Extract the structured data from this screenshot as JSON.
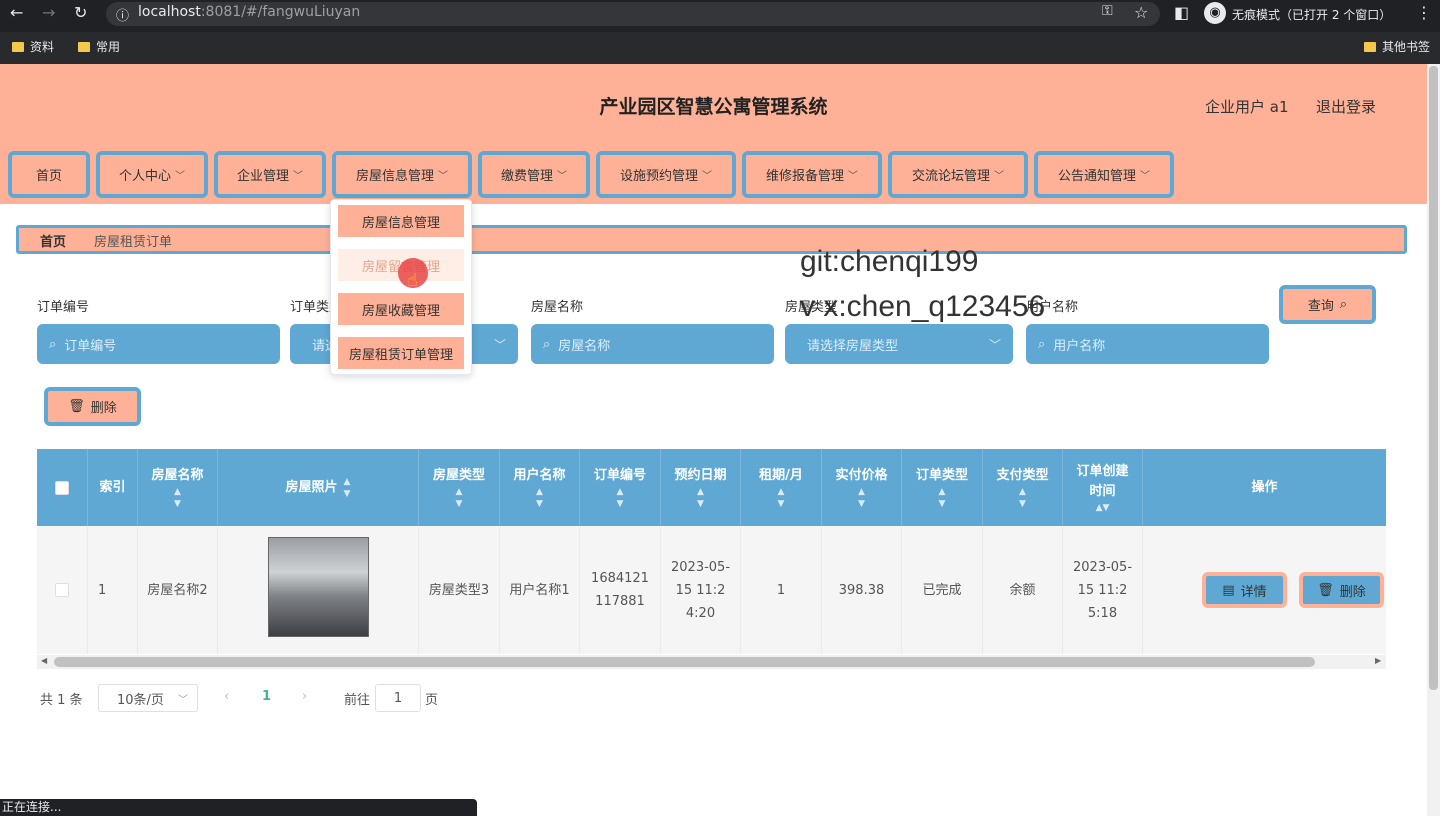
{
  "browser": {
    "url_host": "localhost",
    "url_rest": ":8081/#/fangwuLiuyan",
    "incognito": "无痕模式（已打开 2 个窗口）",
    "bookmarks": [
      "资料",
      "常用"
    ],
    "other_bookmarks": "其他书签",
    "status": "正在连接..."
  },
  "header": {
    "title": "产业园区智慧公寓管理系统",
    "user": "企业用户 a1",
    "logout": "退出登录"
  },
  "nav": {
    "items": [
      "首页",
      "个人中心",
      "企业管理",
      "房屋信息管理",
      "缴费管理",
      "设施预约管理",
      "维修报备管理",
      "交流论坛管理",
      "公告通知管理"
    ]
  },
  "dropdown": {
    "items": [
      "房屋信息管理",
      "房屋留言管理",
      "房屋收藏管理",
      "房屋租赁订单管理"
    ]
  },
  "breadcrumb": {
    "home": "首页",
    "current": "房屋租赁订单"
  },
  "watermark": {
    "line1": "git:chenqi199",
    "line2": "v x:chen_q123456"
  },
  "filters": {
    "order_no_label": "订单编号",
    "order_no_placeholder": "订单编号",
    "order_type_label": "订单类型",
    "order_type_placeholder": "请选择订单类型",
    "house_name_label": "房屋名称",
    "house_name_placeholder": "房屋名称",
    "house_type_label": "房屋类型",
    "house_type_placeholder": "请选择房屋类型",
    "user_name_label": "用户名称",
    "user_name_placeholder": "用户名称",
    "search_button": "查询",
    "delete_button": "删除"
  },
  "table": {
    "headers": [
      "索引",
      "房屋名称",
      "房屋照片",
      "房屋类型",
      "用户名称",
      "订单编号",
      "预约日期",
      "租期/月",
      "实付价格",
      "订单类型",
      "支付类型",
      "订单创建时间",
      "操作"
    ],
    "rows": [
      {
        "index": "1",
        "house_name": "房屋名称2",
        "house_type": "房屋类型3",
        "user_name": "用户名称1",
        "order_no": "1684121117881",
        "book_date": "2023-05-15 11:24:20",
        "months": "1",
        "price": "398.38",
        "order_type": "已完成",
        "pay_type": "余额",
        "created": "2023-05-15 11:25:18",
        "detail_btn": "详情",
        "delete_btn": "删除"
      }
    ]
  },
  "pagination": {
    "total": "共 1 条",
    "page_size": "10条/页",
    "current": "1",
    "goto_label": "前往",
    "goto_value": "1",
    "page_suffix": "页"
  }
}
